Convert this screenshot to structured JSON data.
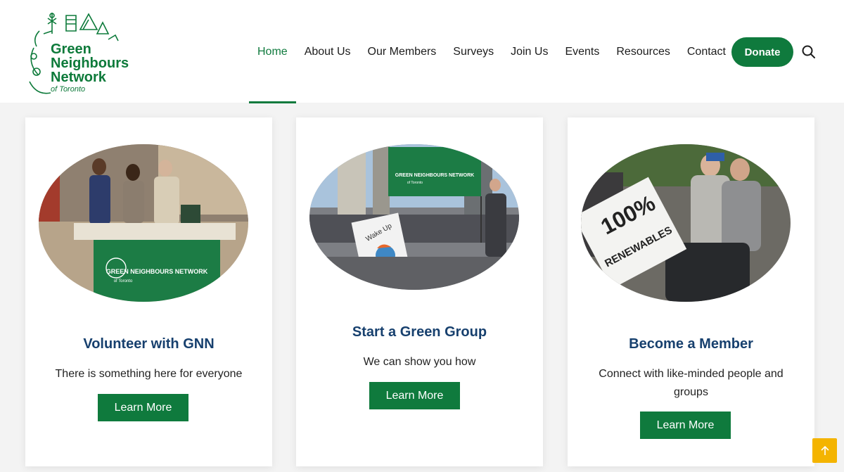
{
  "logo": {
    "line1": "Green",
    "line2": "Neighbours",
    "line3": "Network",
    "line4": "of Toronto"
  },
  "nav": {
    "items": [
      {
        "label": "Home"
      },
      {
        "label": "About Us"
      },
      {
        "label": "Our Members"
      },
      {
        "label": "Surveys"
      },
      {
        "label": "Join Us"
      },
      {
        "label": "Events"
      },
      {
        "label": "Resources"
      },
      {
        "label": "Contact"
      }
    ],
    "donate_label": "Donate"
  },
  "cards": [
    {
      "title": "Volunteer with GNN",
      "description": "There is something here for everyone",
      "button_label": "Learn More",
      "banner_text": "GREEN NEIGHBOURS NETWORK",
      "banner_sub": "of Toronto"
    },
    {
      "title": "Start a Green Group",
      "description": "We can show you how",
      "button_label": "Learn More",
      "banner_text": "GREEN NEIGHBOURS NETWORK",
      "banner_sub": "of Toronto",
      "sign_text": "Wake Up"
    },
    {
      "title": "Become a Member",
      "description": "Connect with like-minded people and groups",
      "button_label": "Learn More",
      "sign_text_1": "100%",
      "sign_text_2": "RENEWABLES"
    }
  ],
  "colors": {
    "brand_green": "#0f7a3d",
    "title_blue": "#17406e",
    "scroll_top": "#f4b400"
  }
}
